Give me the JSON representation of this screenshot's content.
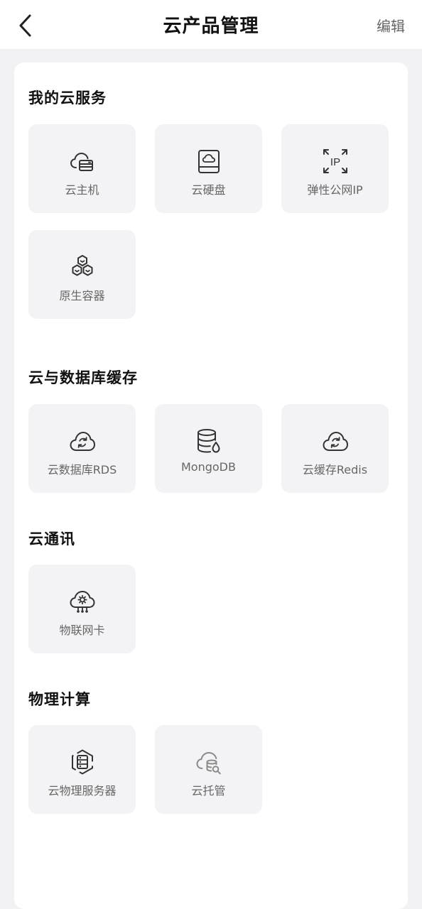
{
  "header": {
    "title": "云产品管理",
    "edit_label": "编辑"
  },
  "icons": {
    "back": "chevron-left-icon"
  },
  "sections": [
    {
      "title": "我的云服务",
      "items": [
        {
          "label": "云主机",
          "icon": "cloud-server-icon"
        },
        {
          "label": "云硬盘",
          "icon": "cloud-disk-icon"
        },
        {
          "label": "弹性公网IP",
          "icon": "elastic-ip-icon"
        },
        {
          "label": "原生容器",
          "icon": "container-icon"
        }
      ]
    },
    {
      "title": "云与数据库缓存",
      "items": [
        {
          "label": "云数据库RDS",
          "icon": "cloud-refresh-icon"
        },
        {
          "label": "MongoDB",
          "icon": "database-icon"
        },
        {
          "label": "云缓存Redis",
          "icon": "cloud-refresh-icon"
        }
      ]
    },
    {
      "title": "云通讯",
      "items": [
        {
          "label": "物联网卡",
          "icon": "iot-cloud-icon"
        }
      ]
    },
    {
      "title": "物理计算",
      "items": [
        {
          "label": "云物理服务器",
          "icon": "hexagon-server-icon"
        },
        {
          "label": "云托管",
          "icon": "cloud-hosting-icon"
        }
      ]
    }
  ]
}
